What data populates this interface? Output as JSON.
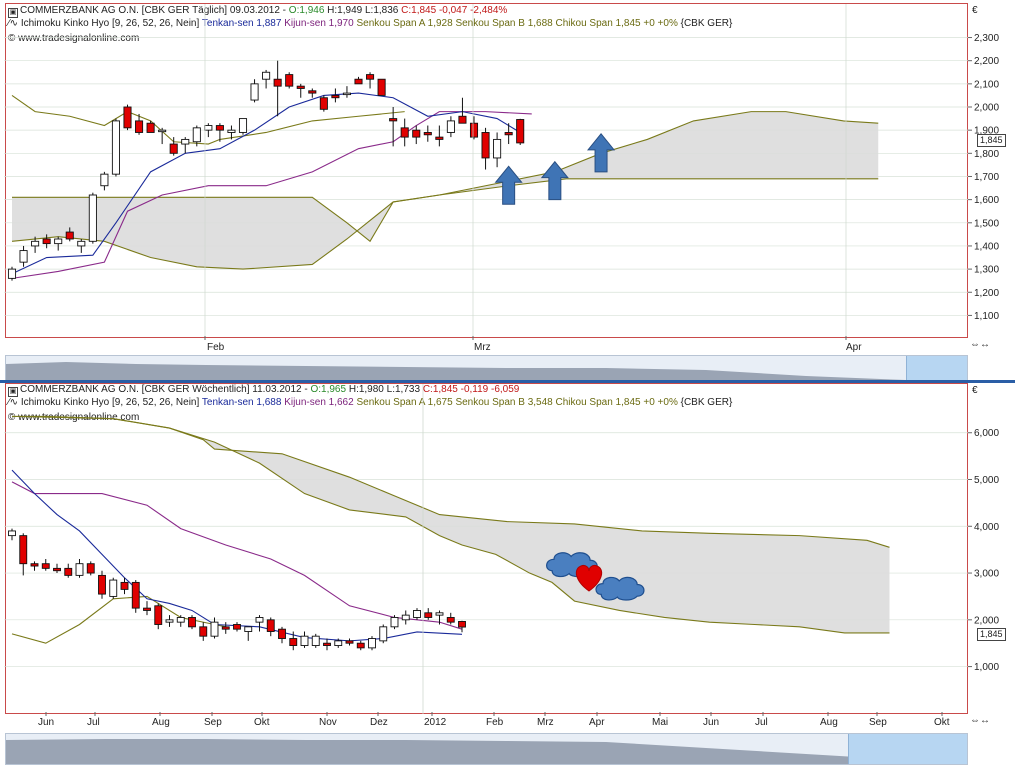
{
  "daily": {
    "header_line1": {
      "instrument": "COMMERZBANK AG O.N. [CBK GER  Täglich] 09.03.2012 -",
      "o": "O:1,946",
      "h": "H:1,949",
      "l": "L:1,836",
      "c": "C:1,845 -0,047 -2,484%"
    },
    "header_line2": {
      "prefix": "Ichimoku Kinko Hyo [9, 26, 52, 26, Nein]",
      "tenkan": "Tenkan-sen 1,887",
      "kijun": "Kijun-sen 1,970",
      "senkou": "Senkou Span A 1,928 Senkou Span B 1,688 Chikou Span 1,845 +0 +0%",
      "suffix": "{CBK GER}"
    },
    "copyright": "© www.tradesignalonline.com",
    "currency": "€",
    "price_badge": "1,845",
    "x_labels": [
      "Feb",
      "Mrz",
      "Apr"
    ]
  },
  "weekly": {
    "header_line1": {
      "instrument": "COMMERZBANK AG O.N. [CBK GER  Wöchentlich] 11.03.2012 -",
      "o": "O:1,965",
      "h": "H:1,980",
      "l": "L:1,733",
      "c": "C:1,845 -0,119 -6,059"
    },
    "header_line2": {
      "prefix": "Ichimoku Kinko Hyo [9, 26, 52, 26, Nein]",
      "tenkan": "Tenkan-sen 1,688",
      "kijun": "Kijun-sen 1,662",
      "senkou": "Senkou Span A 1,675 Senkou Span B 3,548 Chikou Span 1,845 +0 +0%",
      "suffix": "{CBK GER}"
    },
    "copyright": "© www.tradesignalonline.com",
    "currency": "€",
    "price_badge": "1,845",
    "x_labels": [
      "Jun",
      "Jul",
      "Aug",
      "Sep",
      "Okt",
      "Nov",
      "Dez",
      "2012",
      "Feb",
      "Mrz",
      "Apr",
      "Mai",
      "Jun",
      "Jul",
      "Aug",
      "Sep",
      "Okt"
    ]
  },
  "colors": {
    "up_candle": "#ffffff",
    "down_candle": "#e00000",
    "tenkan": "#1a2a9a",
    "kijun": "#8a2a8a",
    "cloud_edge": "#7a7a1a",
    "cloud_fill": "#dcdcdc",
    "arrow": "#3f74b5",
    "heart": "#e00000"
  },
  "chart_data": [
    {
      "type": "candlestick",
      "title": "COMMERZBANK AG O.N. [CBK GER Täglich]",
      "yticks": [
        "1,100",
        "1,200",
        "1,300",
        "1,400",
        "1,500",
        "1,600",
        "1,700",
        "1,800",
        "1,900",
        "2,000",
        "2,100",
        "2,200",
        "2,300"
      ],
      "ylim": [
        1.05,
        2.38
      ],
      "candles": [
        {
          "o": 1.26,
          "h": 1.31,
          "l": 1.25,
          "c": 1.3
        },
        {
          "o": 1.33,
          "h": 1.4,
          "l": 1.31,
          "c": 1.38
        },
        {
          "o": 1.4,
          "h": 1.44,
          "l": 1.37,
          "c": 1.42
        },
        {
          "o": 1.43,
          "h": 1.45,
          "l": 1.39,
          "c": 1.41
        },
        {
          "o": 1.41,
          "h": 1.44,
          "l": 1.38,
          "c": 1.43
        },
        {
          "o": 1.46,
          "h": 1.48,
          "l": 1.42,
          "c": 1.43
        },
        {
          "o": 1.4,
          "h": 1.43,
          "l": 1.37,
          "c": 1.42
        },
        {
          "o": 1.42,
          "h": 1.63,
          "l": 1.41,
          "c": 1.62
        },
        {
          "o": 1.66,
          "h": 1.72,
          "l": 1.64,
          "c": 1.71
        },
        {
          "o": 1.71,
          "h": 1.95,
          "l": 1.7,
          "c": 1.94
        },
        {
          "o": 2.0,
          "h": 2.01,
          "l": 1.9,
          "c": 1.91
        },
        {
          "o": 1.94,
          "h": 1.97,
          "l": 1.88,
          "c": 1.89
        },
        {
          "o": 1.93,
          "h": 1.94,
          "l": 1.89,
          "c": 1.89
        },
        {
          "o": 1.9,
          "h": 1.91,
          "l": 1.84,
          "c": 1.9
        },
        {
          "o": 1.84,
          "h": 1.87,
          "l": 1.79,
          "c": 1.8
        },
        {
          "o": 1.84,
          "h": 1.87,
          "l": 1.8,
          "c": 1.86
        },
        {
          "o": 1.85,
          "h": 1.92,
          "l": 1.83,
          "c": 1.91
        },
        {
          "o": 1.9,
          "h": 1.93,
          "l": 1.87,
          "c": 1.92
        },
        {
          "o": 1.92,
          "h": 1.93,
          "l": 1.85,
          "c": 1.9
        },
        {
          "o": 1.89,
          "h": 1.92,
          "l": 1.86,
          "c": 1.9
        },
        {
          "o": 1.89,
          "h": 1.94,
          "l": 1.88,
          "c": 1.95
        },
        {
          "o": 2.03,
          "h": 2.12,
          "l": 2.02,
          "c": 2.1
        },
        {
          "o": 2.12,
          "h": 2.16,
          "l": 2.08,
          "c": 2.15
        },
        {
          "o": 2.12,
          "h": 2.2,
          "l": 1.96,
          "c": 2.09
        },
        {
          "o": 2.14,
          "h": 2.15,
          "l": 2.08,
          "c": 2.09
        },
        {
          "o": 2.09,
          "h": 2.1,
          "l": 2.04,
          "c": 2.08
        },
        {
          "o": 2.07,
          "h": 2.08,
          "l": 2.04,
          "c": 2.06
        },
        {
          "o": 2.04,
          "h": 2.05,
          "l": 1.98,
          "c": 1.99
        },
        {
          "o": 2.05,
          "h": 2.08,
          "l": 2.02,
          "c": 2.04
        },
        {
          "o": 2.06,
          "h": 2.09,
          "l": 2.04,
          "c": 2.06
        },
        {
          "o": 2.12,
          "h": 2.13,
          "l": 2.1,
          "c": 2.1
        },
        {
          "o": 2.14,
          "h": 2.15,
          "l": 2.08,
          "c": 2.12
        },
        {
          "o": 2.12,
          "h": 2.12,
          "l": 2.05,
          "c": 2.05
        },
        {
          "o": 1.95,
          "h": 2.0,
          "l": 1.83,
          "c": 1.94
        },
        {
          "o": 1.91,
          "h": 1.95,
          "l": 1.83,
          "c": 1.87
        },
        {
          "o": 1.9,
          "h": 1.92,
          "l": 1.84,
          "c": 1.87
        },
        {
          "o": 1.89,
          "h": 1.92,
          "l": 1.85,
          "c": 1.88
        },
        {
          "o": 1.87,
          "h": 1.92,
          "l": 1.83,
          "c": 1.86
        },
        {
          "o": 1.89,
          "h": 1.96,
          "l": 1.87,
          "c": 1.94
        },
        {
          "o": 1.96,
          "h": 2.04,
          "l": 1.93,
          "c": 1.93
        },
        {
          "o": 1.93,
          "h": 1.96,
          "l": 1.86,
          "c": 1.87
        },
        {
          "o": 1.89,
          "h": 1.91,
          "l": 1.73,
          "c": 1.78
        },
        {
          "o": 1.78,
          "h": 1.89,
          "l": 1.74,
          "c": 1.86
        },
        {
          "o": 1.89,
          "h": 1.93,
          "l": 1.84,
          "c": 1.88
        },
        {
          "o": 1.946,
          "h": 1.949,
          "l": 1.836,
          "c": 1.845
        }
      ],
      "tenkan": [
        [
          0,
          1.28
        ],
        [
          3,
          1.35
        ],
        [
          7,
          1.36
        ],
        [
          9,
          1.5
        ],
        [
          12,
          1.72
        ],
        [
          15,
          1.8
        ],
        [
          18,
          1.82
        ],
        [
          21,
          1.9
        ],
        [
          24,
          2.0
        ],
        [
          27,
          2.05
        ],
        [
          30,
          2.06
        ],
        [
          33,
          2.04
        ],
        [
          36,
          1.96
        ],
        [
          39,
          1.98
        ],
        [
          42,
          1.95
        ],
        [
          44,
          1.89
        ]
      ],
      "kijun": [
        [
          0,
          1.26
        ],
        [
          4,
          1.29
        ],
        [
          8,
          1.33
        ],
        [
          10,
          1.55
        ],
        [
          13,
          1.62
        ],
        [
          17,
          1.66
        ],
        [
          22,
          1.66
        ],
        [
          26,
          1.72
        ],
        [
          30,
          1.82
        ],
        [
          33,
          1.85
        ],
        [
          35,
          1.92
        ],
        [
          37,
          1.98
        ],
        [
          41,
          1.98
        ],
        [
          45,
          1.97
        ]
      ],
      "chikou": [
        [
          0,
          2.05
        ],
        [
          2,
          1.98
        ],
        [
          5,
          1.96
        ],
        [
          8,
          1.92
        ],
        [
          10,
          1.98
        ],
        [
          12,
          1.94
        ],
        [
          14,
          1.85
        ],
        [
          17,
          1.84
        ],
        [
          18,
          1.86
        ],
        [
          22,
          1.89
        ],
        [
          26,
          1.94
        ],
        [
          30,
          1.96
        ],
        [
          34,
          1.98
        ]
      ],
      "senkou_a": [
        [
          0,
          1.42
        ],
        [
          4,
          1.44
        ],
        [
          8,
          1.42
        ],
        [
          12,
          1.35
        ],
        [
          16,
          1.31
        ],
        [
          20,
          1.3
        ],
        [
          26,
          1.32
        ],
        [
          29,
          1.43
        ],
        [
          33,
          1.59
        ],
        [
          37,
          1.62
        ],
        [
          43,
          1.68
        ],
        [
          47,
          1.72
        ],
        [
          51,
          1.8
        ],
        [
          55,
          1.86
        ],
        [
          59,
          1.94
        ],
        [
          64,
          1.98
        ],
        [
          67,
          1.98
        ],
        [
          72,
          1.94
        ],
        [
          75,
          1.93
        ]
      ],
      "senkou_b": [
        [
          0,
          1.61
        ],
        [
          20,
          1.61
        ],
        [
          26,
          1.61
        ],
        [
          29,
          1.5
        ],
        [
          31,
          1.42
        ],
        [
          33,
          1.59
        ],
        [
          37,
          1.62
        ],
        [
          43,
          1.66
        ],
        [
          48,
          1.69
        ],
        [
          75,
          1.69
        ]
      ],
      "arrows": [
        [
          43,
          1.58
        ],
        [
          47,
          1.6
        ],
        [
          51,
          1.72
        ]
      ]
    },
    {
      "type": "candlestick",
      "title": "COMMERZBANK AG O.N. [CBK GER Wöchentlich]",
      "yticks": [
        "1,000",
        "2,000",
        "3,000",
        "4,000",
        "5,000",
        "6,000"
      ],
      "ylim": [
        0.2,
        6.7
      ],
      "candles": [
        {
          "o": 3.8,
          "h": 3.95,
          "l": 3.7,
          "c": 3.9
        },
        {
          "o": 3.8,
          "h": 3.85,
          "l": 2.95,
          "c": 3.2
        },
        {
          "o": 3.2,
          "h": 3.25,
          "l": 3.05,
          "c": 3.15
        },
        {
          "o": 3.2,
          "h": 3.3,
          "l": 3.05,
          "c": 3.1
        },
        {
          "o": 3.1,
          "h": 3.2,
          "l": 3.0,
          "c": 3.05
        },
        {
          "o": 3.1,
          "h": 3.2,
          "l": 2.9,
          "c": 2.95
        },
        {
          "o": 2.95,
          "h": 3.3,
          "l": 2.9,
          "c": 3.2
        },
        {
          "o": 3.2,
          "h": 3.25,
          "l": 2.95,
          "c": 3.0
        },
        {
          "o": 2.95,
          "h": 3.05,
          "l": 2.45,
          "c": 2.55
        },
        {
          "o": 2.5,
          "h": 2.9,
          "l": 2.45,
          "c": 2.85
        },
        {
          "o": 2.8,
          "h": 2.9,
          "l": 2.55,
          "c": 2.65
        },
        {
          "o": 2.8,
          "h": 2.85,
          "l": 2.15,
          "c": 2.25
        },
        {
          "o": 2.25,
          "h": 2.4,
          "l": 2.1,
          "c": 2.2
        },
        {
          "o": 2.3,
          "h": 2.35,
          "l": 1.8,
          "c": 1.9
        },
        {
          "o": 1.95,
          "h": 2.1,
          "l": 1.85,
          "c": 2.0
        },
        {
          "o": 1.95,
          "h": 2.1,
          "l": 1.85,
          "c": 2.05
        },
        {
          "o": 2.05,
          "h": 2.1,
          "l": 1.8,
          "c": 1.85
        },
        {
          "o": 1.85,
          "h": 1.95,
          "l": 1.55,
          "c": 1.65
        },
        {
          "o": 1.65,
          "h": 2.05,
          "l": 1.6,
          "c": 1.95
        },
        {
          "o": 1.85,
          "h": 1.95,
          "l": 1.7,
          "c": 1.8
        },
        {
          "o": 1.9,
          "h": 1.95,
          "l": 1.75,
          "c": 1.8
        },
        {
          "o": 1.75,
          "h": 1.85,
          "l": 1.55,
          "c": 1.85
        },
        {
          "o": 1.95,
          "h": 2.1,
          "l": 1.75,
          "c": 2.05
        },
        {
          "o": 2.0,
          "h": 2.05,
          "l": 1.65,
          "c": 1.75
        },
        {
          "o": 1.8,
          "h": 1.85,
          "l": 1.5,
          "c": 1.6
        },
        {
          "o": 1.6,
          "h": 1.75,
          "l": 1.35,
          "c": 1.45
        },
        {
          "o": 1.45,
          "h": 1.75,
          "l": 1.4,
          "c": 1.65
        },
        {
          "o": 1.45,
          "h": 1.7,
          "l": 1.4,
          "c": 1.65
        },
        {
          "o": 1.5,
          "h": 1.6,
          "l": 1.35,
          "c": 1.45
        },
        {
          "o": 1.45,
          "h": 1.6,
          "l": 1.4,
          "c": 1.55
        },
        {
          "o": 1.55,
          "h": 1.6,
          "l": 1.45,
          "c": 1.5
        },
        {
          "o": 1.5,
          "h": 1.55,
          "l": 1.35,
          "c": 1.4
        },
        {
          "o": 1.4,
          "h": 1.65,
          "l": 1.35,
          "c": 1.6
        },
        {
          "o": 1.55,
          "h": 1.9,
          "l": 1.5,
          "c": 1.85
        },
        {
          "o": 1.85,
          "h": 2.1,
          "l": 1.8,
          "c": 2.05
        },
        {
          "o": 2.0,
          "h": 2.2,
          "l": 1.9,
          "c": 2.1
        },
        {
          "o": 2.05,
          "h": 2.25,
          "l": 2.0,
          "c": 2.2
        },
        {
          "o": 2.15,
          "h": 2.25,
          "l": 2.0,
          "c": 2.05
        },
        {
          "o": 2.1,
          "h": 2.2,
          "l": 1.9,
          "c": 2.15
        },
        {
          "o": 2.05,
          "h": 2.15,
          "l": 1.9,
          "c": 1.95
        },
        {
          "o": 1.965,
          "h": 1.98,
          "l": 1.733,
          "c": 1.845
        }
      ],
      "tenkan": [
        [
          0,
          5.2
        ],
        [
          2,
          4.7
        ],
        [
          4,
          4.25
        ],
        [
          6,
          3.9
        ],
        [
          8,
          3.4
        ],
        [
          10,
          2.9
        ],
        [
          12,
          2.45
        ],
        [
          14,
          2.35
        ],
        [
          16,
          2.2
        ],
        [
          18,
          1.9
        ],
        [
          22,
          1.85
        ],
        [
          26,
          1.62
        ],
        [
          30,
          1.55
        ],
        [
          33,
          1.6
        ],
        [
          36,
          1.74
        ],
        [
          40,
          1.69
        ]
      ],
      "kijun": [
        [
          0,
          4.95
        ],
        [
          2,
          4.7
        ],
        [
          8,
          4.7
        ],
        [
          12,
          4.45
        ],
        [
          15,
          3.95
        ],
        [
          19,
          3.6
        ],
        [
          23,
          3.3
        ],
        [
          26,
          2.95
        ],
        [
          30,
          2.3
        ],
        [
          34,
          2.05
        ],
        [
          38,
          1.95
        ],
        [
          40,
          1.8
        ]
      ],
      "chikou": [
        [
          0,
          1.7
        ],
        [
          3,
          1.5
        ],
        [
          6,
          1.9
        ],
        [
          9,
          2.45
        ],
        [
          12,
          2.5
        ],
        [
          15,
          2.05
        ],
        [
          18,
          1.9
        ],
        [
          19,
          1.85
        ]
      ],
      "senkou_a": [
        [
          0,
          6.35
        ],
        [
          3,
          6.35
        ],
        [
          9,
          6.3
        ],
        [
          14,
          6.1
        ],
        [
          18,
          5.8
        ],
        [
          22,
          5.35
        ],
        [
          26,
          4.7
        ],
        [
          30,
          4.35
        ],
        [
          35,
          4.2
        ],
        [
          38,
          3.8
        ],
        [
          40,
          3.6
        ],
        [
          43,
          3.4
        ],
        [
          46,
          3.0
        ],
        [
          48,
          2.8
        ],
        [
          50,
          2.4
        ],
        [
          54,
          2.2
        ],
        [
          58,
          2.05
        ],
        [
          62,
          1.95
        ],
        [
          66,
          1.9
        ],
        [
          70,
          1.85
        ],
        [
          74,
          1.72
        ],
        [
          78,
          1.72
        ]
      ],
      "senkou_b": [
        [
          0,
          6.35
        ],
        [
          9,
          6.3
        ],
        [
          14,
          6.1
        ],
        [
          17,
          5.85
        ],
        [
          18,
          5.65
        ],
        [
          24,
          5.55
        ],
        [
          30,
          5.05
        ],
        [
          34,
          4.65
        ],
        [
          38,
          4.25
        ],
        [
          44,
          4.1
        ],
        [
          50,
          4.05
        ],
        [
          56,
          3.9
        ],
        [
          62,
          3.85
        ],
        [
          70,
          3.8
        ],
        [
          76,
          3.7
        ],
        [
          78,
          3.55
        ]
      ]
    }
  ]
}
